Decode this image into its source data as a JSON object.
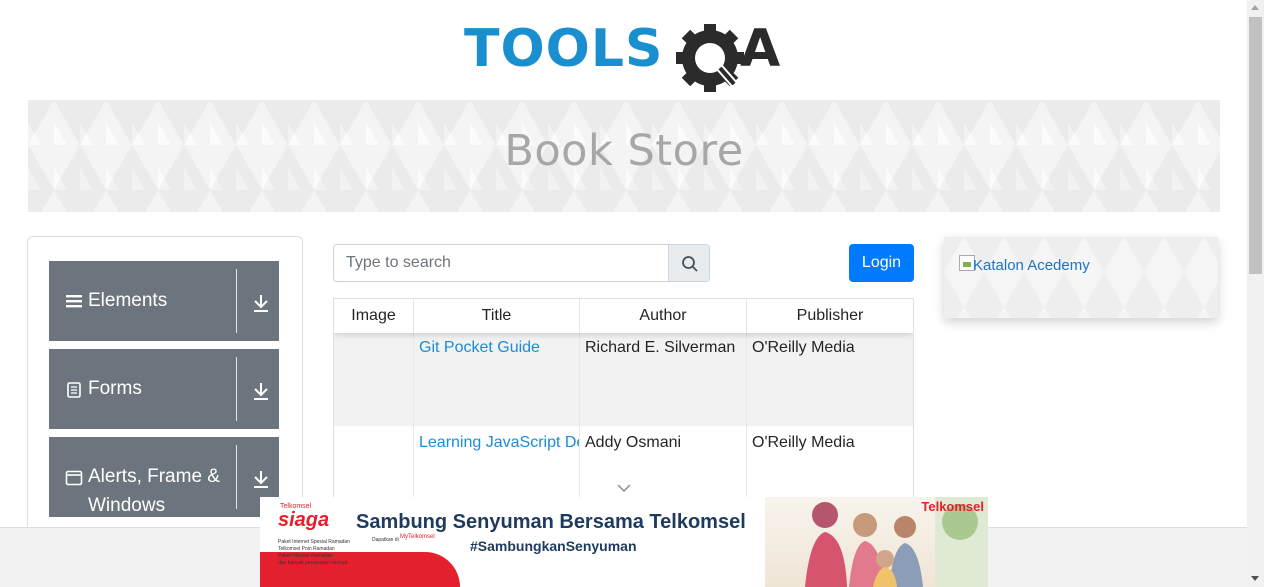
{
  "logo": {
    "text_left": "TOOLS",
    "text_right": "A",
    "accent": "#1a8fd0",
    "dark": "#2b2b2b"
  },
  "banner": {
    "title": "Book Store"
  },
  "sidebar": {
    "groups": [
      {
        "label": "Elements",
        "icon": "hamburger-icon"
      },
      {
        "label": "Forms",
        "icon": "document-icon"
      },
      {
        "label": "Alerts, Frame &",
        "label2": "Windows",
        "icon": "window-icon"
      }
    ]
  },
  "search": {
    "placeholder": "Type to search"
  },
  "login": {
    "label": "Login"
  },
  "table": {
    "headers": [
      "Image",
      "Title",
      "Author",
      "Publisher"
    ],
    "rows": [
      {
        "title": "Git Pocket Guide",
        "author": "Richard E. Silverman",
        "publisher": "O'Reilly Media"
      },
      {
        "title": "Learning JavaScript De",
        "author": "Addy Osmani",
        "publisher": "O'Reilly Media"
      }
    ]
  },
  "side_ad": {
    "alt": "Katalon Acedemy"
  },
  "bottom_ad": {
    "brand_small": "Telkomsel",
    "brand": "siaga",
    "headline": "Sambung Senyuman Bersama Telkomsel",
    "tagline": "#SambungkanSenyuman",
    "telkomsel": "Telkomsel",
    "lines": [
      "Paket Internet Spesial Ramadan",
      "Telkomsel Poin Ramadan",
      "Paket Hiburan Ramadan",
      "dan banyak penawaran lainnya"
    ],
    "dapat": "Dapatkan di",
    "app": "MyTelkomsel"
  },
  "colors": {
    "primary": "#007bff",
    "sidebar_bg": "#6c757d",
    "link": "#1a8cd8"
  }
}
